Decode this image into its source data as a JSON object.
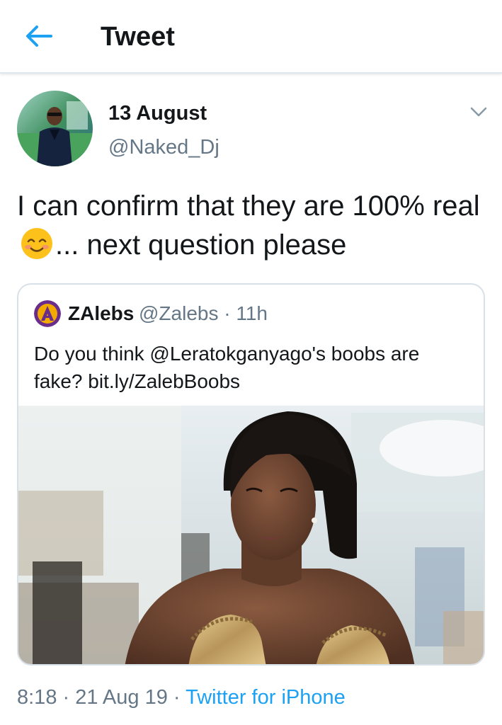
{
  "header": {
    "title": "Tweet",
    "back_icon": "arrow-left-icon",
    "accent_color": "#1da1f2"
  },
  "tweet": {
    "author_name": "13 August",
    "author_handle": "@Naked_Dj",
    "more_icon": "chevron-down-icon",
    "text_before_emoji": "I can confirm that they are 100% real ",
    "emoji": "smiling-face-with-smiling-eyes-emoji",
    "text_after_emoji": "... next question please",
    "quoted": {
      "name": "ZAlebs",
      "handle_time": "@Zalebs · 11h",
      "text": "Do you think @Leratokganyago's boobs are fake? bit.ly/ZalebBoobs",
      "image": "photo-woman-in-gold-strapless-dress"
    },
    "timestamp": "8:18 · 21 Aug 19 · ",
    "source": "Twitter for iPhone",
    "secondary_color": "#657786"
  }
}
